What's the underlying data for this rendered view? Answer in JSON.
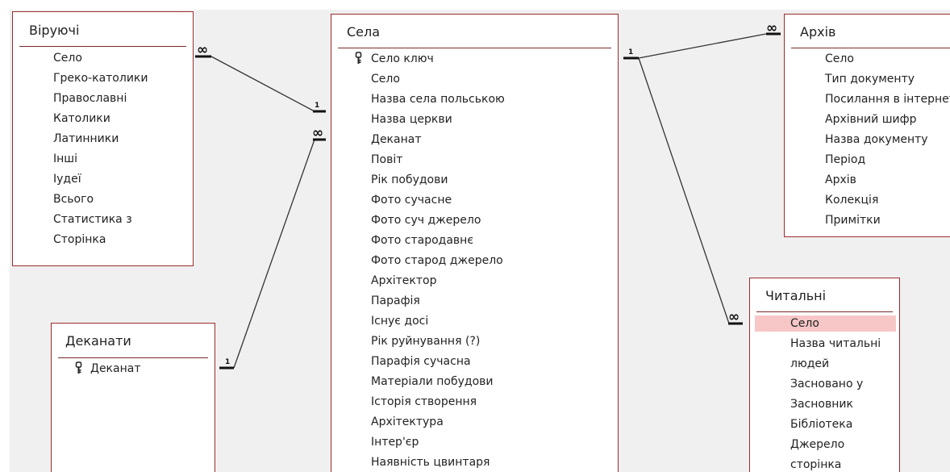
{
  "tables": {
    "viruiuchi": {
      "title": "Віруючі",
      "fields": [
        "Село",
        "Греко-католики",
        "Православні",
        "Католики",
        "Латинники",
        "Інші",
        "Іудеї",
        "Всього",
        "Статистика з",
        "Сторінка"
      ]
    },
    "dekanaty": {
      "title": "Деканати",
      "key_field": "Деканат"
    },
    "sela": {
      "title": "Села",
      "key_field": "Село ключ",
      "fields": [
        "Село",
        "Назва села польською",
        "Назва церкви",
        "Деканат",
        "Повіт",
        "Рік побудови",
        "Фото сучасне",
        "Фото суч джерело",
        "Фото стародавнє",
        "Фото старод джерело",
        "Архітектор",
        "Парафія",
        "Існує досі",
        "Рік руйнування (?)",
        "Парафія сучасна",
        "Матеріали побудови",
        "Історія створення",
        "Архітектура",
        "Інтер'єр",
        "Наявність цвинтаря"
      ]
    },
    "arkhiv": {
      "title": "Архів",
      "fields": [
        "Село",
        "Тип документу",
        "Посилання в інтернеті",
        "Архівний шифр",
        "Назва документу",
        "Період",
        "Архів",
        "Колекція",
        "Примітки"
      ]
    },
    "chytalni": {
      "title": "Читальні",
      "selected_field": "Село",
      "fields": [
        "Назва читальні",
        "людей",
        "Засновано у",
        "Засновник",
        "Бібліотека",
        "Джерело",
        "сторінка"
      ]
    }
  },
  "relationships": {
    "one_label": "1",
    "many_label": "∞"
  },
  "colors": {
    "border": "#9b2c2c",
    "selection": "#f7c6c7",
    "canvas": "#f0f0f0"
  }
}
